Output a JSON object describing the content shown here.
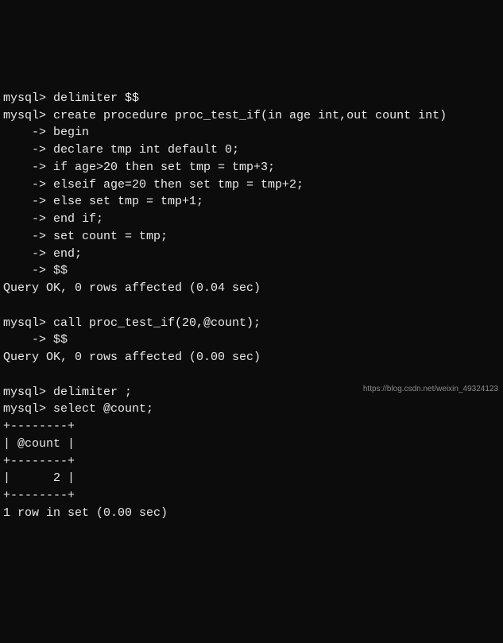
{
  "terminal": {
    "lines": [
      "mysql> delimiter $$",
      "mysql> create procedure proc_test_if(in age int,out count int)",
      "    -> begin",
      "    -> declare tmp int default 0;",
      "    -> if age>20 then set tmp = tmp+3;",
      "    -> elseif age=20 then set tmp = tmp+2;",
      "    -> else set tmp = tmp+1;",
      "    -> end if;",
      "    -> set count = tmp;",
      "    -> end;",
      "    -> $$",
      "Query OK, 0 rows affected (0.04 sec)",
      "",
      "mysql> call proc_test_if(20,@count);",
      "    -> $$",
      "Query OK, 0 rows affected (0.00 sec)",
      "",
      "mysql> delimiter ;",
      "mysql> select @count;",
      "+--------+",
      "| @count |",
      "+--------+",
      "|      2 |",
      "+--------+",
      "1 row in set (0.00 sec)"
    ]
  },
  "watermark": {
    "text": "https://blog.csdn.net/weixin_49324123"
  }
}
